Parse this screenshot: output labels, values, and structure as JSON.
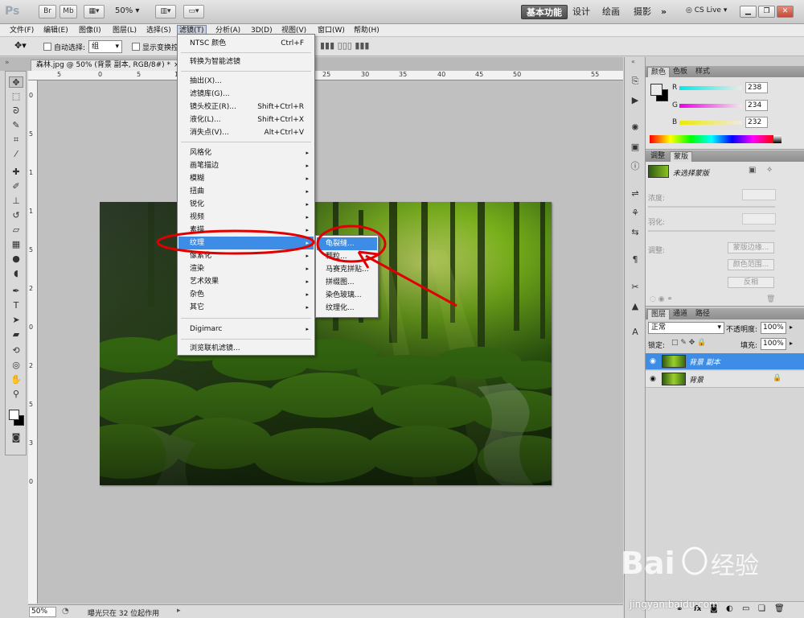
{
  "app": {
    "logo": "Ps",
    "bar_buttons": [
      "Br",
      "Mb"
    ],
    "zoom": "50%",
    "workspaces": [
      "基本功能",
      "设计",
      "绘画",
      "摄影"
    ],
    "more": "»",
    "cs_live": "CS Live"
  },
  "menubar": {
    "items": [
      "文件(F)",
      "编辑(E)",
      "图像(I)",
      "图层(L)",
      "选择(S)",
      "滤镜(T)",
      "分析(A)",
      "3D(D)",
      "视图(V)",
      "窗口(W)",
      "帮助(H)"
    ],
    "active_index": 5
  },
  "options_bar": {
    "auto_select_label": "自动选择:",
    "auto_select_value": "组",
    "show_transform_label": "显示变换控"
  },
  "document": {
    "tab_title": "森林.jpg @ 50% (背景 副本, RGB/8#) *",
    "close": "×",
    "ruler_top": [
      "5",
      "0",
      "5",
      "10",
      "15",
      "20",
      "25",
      "30",
      "35",
      "40",
      "45",
      "50",
      "55"
    ],
    "ruler_left": [
      "0",
      "5",
      "1",
      "1",
      "5",
      "2",
      "0",
      "2",
      "5",
      "3",
      "0"
    ]
  },
  "status_bar": {
    "zoom": "50%",
    "message": "曝光只在 32 位起作用"
  },
  "filter_menu": {
    "groups": [
      [
        {
          "label": "NTSC 颜色",
          "shortcut": "Ctrl+F"
        }
      ],
      [
        {
          "label": "转换为智能滤镜"
        }
      ],
      [
        {
          "label": "抽出(X)..."
        },
        {
          "label": "滤镜库(G)..."
        },
        {
          "label": "镜头校正(R)...",
          "shortcut": "Shift+Ctrl+R"
        },
        {
          "label": "液化(L)...",
          "shortcut": "Shift+Ctrl+X"
        },
        {
          "label": "消失点(V)...",
          "shortcut": "Alt+Ctrl+V"
        }
      ],
      [
        {
          "label": "风格化",
          "submenu": true
        },
        {
          "label": "画笔描边",
          "submenu": true
        },
        {
          "label": "模糊",
          "submenu": true
        },
        {
          "label": "扭曲",
          "submenu": true
        },
        {
          "label": "锐化",
          "submenu": true
        },
        {
          "label": "视频",
          "submenu": true
        },
        {
          "label": "素描",
          "submenu": true
        },
        {
          "label": "纹理",
          "submenu": true,
          "highlighted": true
        },
        {
          "label": "像素化",
          "submenu": true
        },
        {
          "label": "渲染",
          "submenu": true
        },
        {
          "label": "艺术效果",
          "submenu": true
        },
        {
          "label": "杂色",
          "submenu": true
        },
        {
          "label": "其它",
          "submenu": true
        }
      ],
      [
        {
          "label": "Digimarc",
          "submenu": true
        }
      ],
      [
        {
          "label": "浏览联机滤镜..."
        }
      ]
    ],
    "arrow": "▸"
  },
  "texture_submenu": {
    "items": [
      {
        "label": "龟裂缝...",
        "highlighted": true
      },
      {
        "label": "颗粒..."
      },
      {
        "label": "马赛克拼贴..."
      },
      {
        "label": "拼缀图..."
      },
      {
        "label": "染色玻璃..."
      },
      {
        "label": "纹理化..."
      }
    ]
  },
  "color_panel": {
    "tabs": [
      "颜色",
      "色板",
      "样式"
    ],
    "r_label": "R",
    "r": "238",
    "g_label": "G",
    "g": "234",
    "b_label": "B",
    "b": "232"
  },
  "masks_panel": {
    "tabs": [
      "调整",
      "蒙版"
    ],
    "title": "未选择蒙版",
    "density_label": "浓度:",
    "feather_label": "羽化:",
    "refine_label": "调整:",
    "buttons": [
      "蒙版边缘...",
      "颜色范围...",
      "反相"
    ]
  },
  "layers_panel": {
    "tabs": [
      "图层",
      "通道",
      "路径"
    ],
    "blend_mode": "正常",
    "opacity_label": "不透明度:",
    "opacity": "100%",
    "lock_label": "锁定:",
    "fill_label": "填充:",
    "fill": "100%",
    "layers": [
      {
        "name": "背景 副本",
        "selected": true
      },
      {
        "name": "背景",
        "locked": true
      }
    ],
    "footer_icons": [
      "link-icon",
      "fx-icon",
      "mask-icon",
      "adjustment-icon",
      "group-icon",
      "new-layer-icon",
      "trash-icon"
    ],
    "fx_label": "fx"
  },
  "colors": {
    "accent": "#3d8ce6",
    "annotation": "#e00000"
  },
  "watermark": {
    "text": "jingyan.baidu.com"
  }
}
